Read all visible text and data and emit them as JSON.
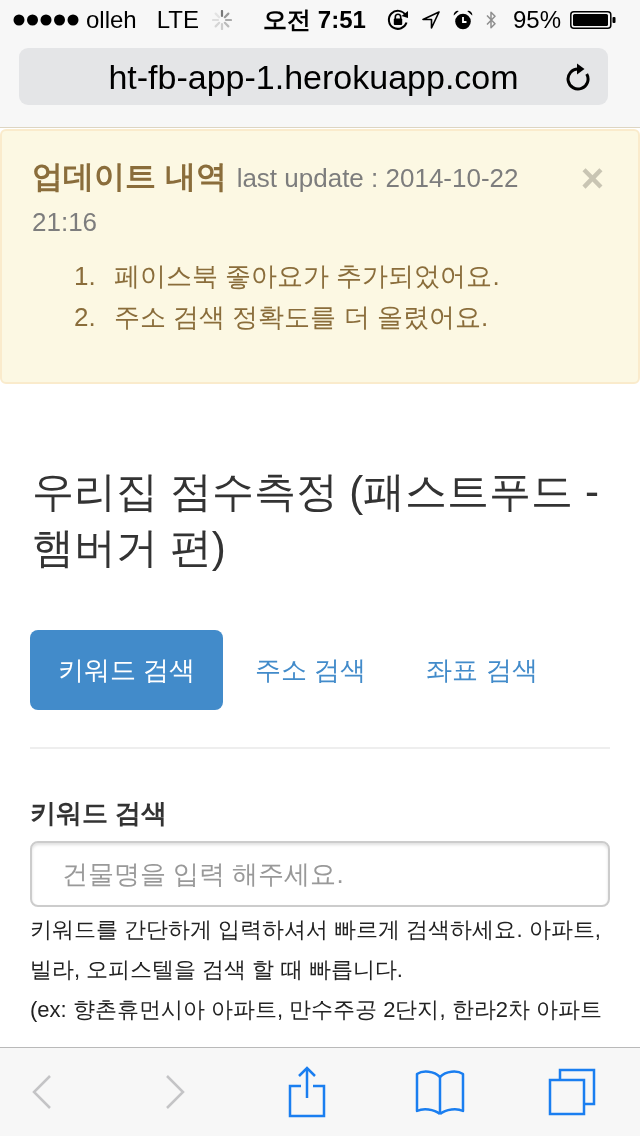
{
  "status_bar": {
    "carrier": "olleh",
    "network": "LTE",
    "time": "오전 7:51",
    "battery": "95%"
  },
  "address_bar": {
    "url": "ht-fb-app-1.herokuapp.com"
  },
  "alert": {
    "title": "업데이트 내역",
    "subtitle": "last update : 2014-10-22 21:16",
    "close": "×",
    "items": [
      {
        "number": "1.",
        "text": "페이스북 좋아요가 추가되었어요."
      },
      {
        "number": "2.",
        "text": "주소 검색 정확도를 더 올렸어요."
      }
    ]
  },
  "page": {
    "heading": "우리집 점수측정 (패스트푸드 - 햄버거 편)",
    "tabs": [
      {
        "label": "키워드 검색",
        "selected": true
      },
      {
        "label": "주소 검색",
        "selected": false
      },
      {
        "label": "좌표 검색",
        "selected": false
      }
    ],
    "search": {
      "label": "키워드 검색",
      "placeholder": "건물명을 입력 해주세요.",
      "help": [
        "키워드를 간단하게 입력하셔서 빠르게 검색하세요. 아파트,빌라, 오피스텔을 검색 할 때 빠릅니다.",
        "(ex: 향촌휴먼시아 아파트, 만수주공 2단지, 한라2차 아파트"
      ]
    }
  },
  "toolbar": {
    "buttons": [
      {
        "kind": "back",
        "disabled": true
      },
      {
        "kind": "forward",
        "disabled": true
      },
      {
        "kind": "share",
        "disabled": false
      },
      {
        "kind": "bookmarks",
        "disabled": false
      },
      {
        "kind": "tabs",
        "disabled": false
      }
    ]
  }
}
